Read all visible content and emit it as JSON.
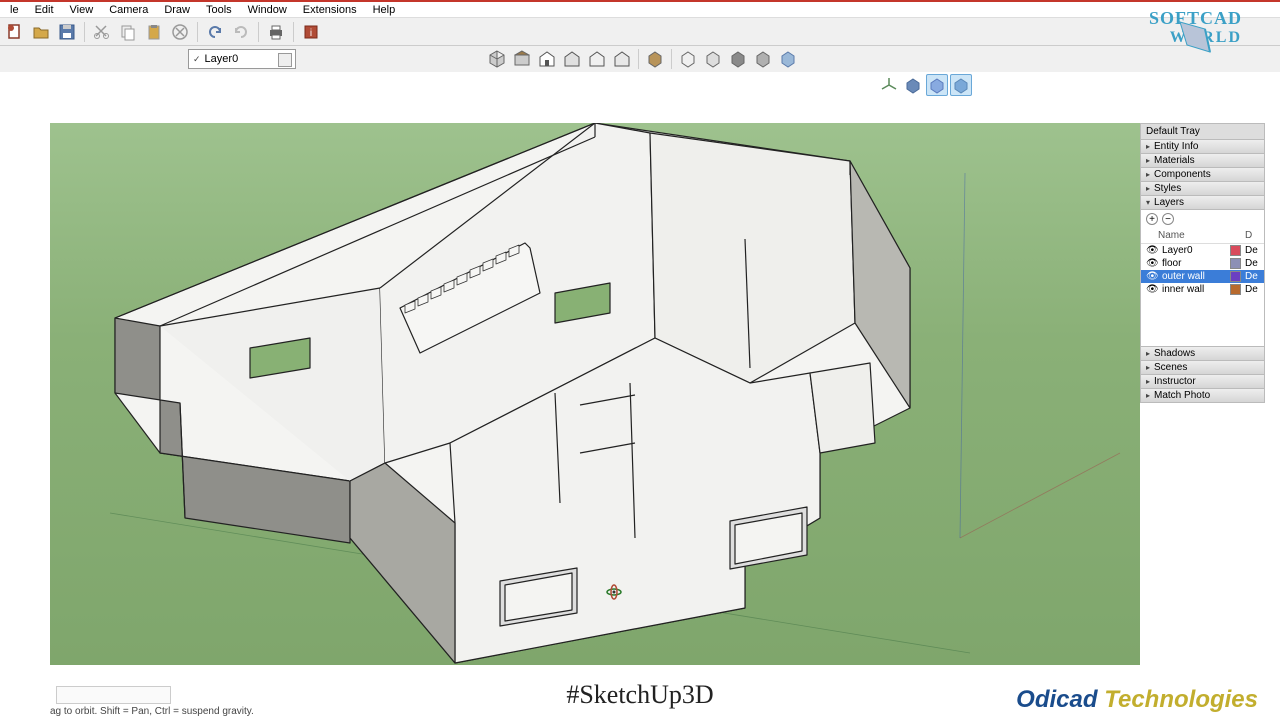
{
  "menu": [
    "le",
    "Edit",
    "View",
    "Camera",
    "Draw",
    "Tools",
    "Window",
    "Extensions",
    "Help"
  ],
  "layer_dropdown": {
    "selected": "Layer0"
  },
  "tray": {
    "title": "Default Tray",
    "panels": [
      "Entity Info",
      "Materials",
      "Components",
      "Styles",
      "Layers"
    ],
    "panels_bottom": [
      "Shadows",
      "Scenes",
      "Instructor",
      "Match Photo"
    ],
    "layers": {
      "header_name": "Name",
      "header_d": "D",
      "rows": [
        {
          "name": "Layer0",
          "color": "#d94b5c",
          "d": "De",
          "selected": false
        },
        {
          "name": "floor",
          "color": "#8c8fb5",
          "d": "De",
          "selected": false
        },
        {
          "name": "outer wall",
          "color": "#6b3fc2",
          "d": "De",
          "selected": true
        },
        {
          "name": "inner wall",
          "color": "#b86a2e",
          "d": "De",
          "selected": false
        }
      ]
    }
  },
  "logo": {
    "top": "SOFTCAD",
    "bottom": "WORLD"
  },
  "hashtag": "#SketchUp3D",
  "footer_brand": {
    "a": "Odicad ",
    "b": "Technologies"
  },
  "status_hint": "ag to orbit. Shift = Pan, Ctrl = suspend gravity."
}
